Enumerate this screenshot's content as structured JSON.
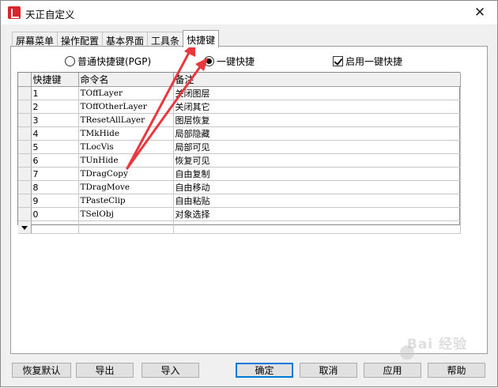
{
  "window": {
    "title": "天正自定义",
    "close_glyph": "✕"
  },
  "tabs": [
    {
      "label": "屏幕菜单",
      "active": false
    },
    {
      "label": "操作配置",
      "active": false
    },
    {
      "label": "基本界面",
      "active": false
    },
    {
      "label": "工具条",
      "active": false
    },
    {
      "label": "快捷键",
      "active": true
    }
  ],
  "options": {
    "radio_pgp": {
      "label": "普通快捷键(PGP)",
      "checked": false
    },
    "radio_onekey": {
      "label": "一键快捷",
      "checked": true
    },
    "enable_onekey": {
      "label": "启用一键快捷",
      "checked": true
    }
  },
  "grid": {
    "columns": [
      "快捷键",
      "命令名",
      "备注"
    ],
    "rows": [
      [
        "1",
        "TOffLayer",
        "关闭图层"
      ],
      [
        "2",
        "TOffOtherLayer",
        "关闭其它"
      ],
      [
        "3",
        "TResetAllLayer",
        "图层恢复"
      ],
      [
        "4",
        "TMkHide",
        "局部隐藏"
      ],
      [
        "5",
        "TLocVis",
        "局部可见"
      ],
      [
        "6",
        "TUnHide",
        "恢复可见"
      ],
      [
        "7",
        "TDragCopy",
        "自由复制"
      ],
      [
        "8",
        "TDragMove",
        "自由移动"
      ],
      [
        "9",
        "TPasteClip",
        "自由粘贴"
      ],
      [
        "0",
        "TSelObj",
        "对象选择"
      ]
    ]
  },
  "buttons": {
    "restore_default": "恢复默认",
    "export": "导出",
    "import": "导入",
    "ok": "确定",
    "cancel": "取消",
    "apply": "应用",
    "help": "帮助"
  },
  "watermark": {
    "text": "Bai 经验"
  },
  "colors": {
    "annotation_arrow": "#e8383d",
    "default_button_border": "#0078d7"
  },
  "icons": {
    "app": "tangent-app-icon",
    "close": "close-icon",
    "dropdown": "dropdown-arrow-icon"
  }
}
